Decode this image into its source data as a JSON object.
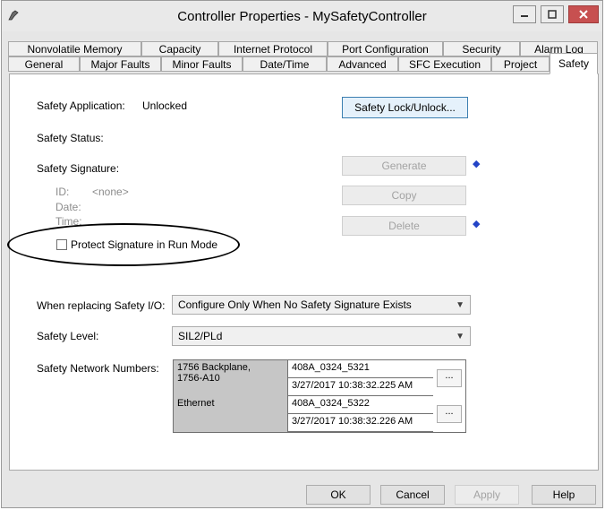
{
  "window": {
    "title": "Controller Properties - MySafetyController",
    "controls": {
      "minimize": "minimize",
      "maximize": "maximize",
      "close": "close"
    }
  },
  "tabs_row1": [
    "Nonvolatile Memory",
    "Capacity",
    "Internet Protocol",
    "Port Configuration",
    "Security",
    "Alarm Log"
  ],
  "tabs_row2": [
    "General",
    "Major Faults",
    "Minor Faults",
    "Date/Time",
    "Advanced",
    "SFC Execution",
    "Project",
    "Safety"
  ],
  "active_tab": "Safety",
  "safety": {
    "application_label": "Safety Application:",
    "application_value": "Unlocked",
    "lock_button": "Safety Lock/Unlock...",
    "status_label": "Safety Status:",
    "signature_label": "Safety Signature:",
    "id_label": "ID:",
    "id_value": "<none>",
    "date_label": "Date:",
    "time_label": "Time:",
    "generate_button": "Generate",
    "copy_button": "Copy",
    "delete_button": "Delete",
    "protect_label": "Protect Signature in Run Mode",
    "protect_checked": false,
    "replacing_label": "When replacing Safety I/O:",
    "replacing_value": "Configure Only When No Safety Signature Exists",
    "level_label": "Safety Level:",
    "level_value": "SIL2/PLd",
    "snn_label": "Safety Network Numbers:",
    "snn": [
      {
        "network": "1756 Backplane,\n1756-A10",
        "number": "408A_0324_5321",
        "timestamp": "3/27/2017 10:38:32.225 AM",
        "button": "..."
      },
      {
        "network": "Ethernet",
        "number": "408A_0324_5322",
        "timestamp": "3/27/2017 10:38:32.226 AM",
        "button": "..."
      }
    ]
  },
  "footer": {
    "ok": "OK",
    "cancel": "Cancel",
    "apply": "Apply",
    "help": "Help"
  },
  "colors": {
    "accent_arrow": "#2344c7",
    "close_button": "#c75050"
  }
}
